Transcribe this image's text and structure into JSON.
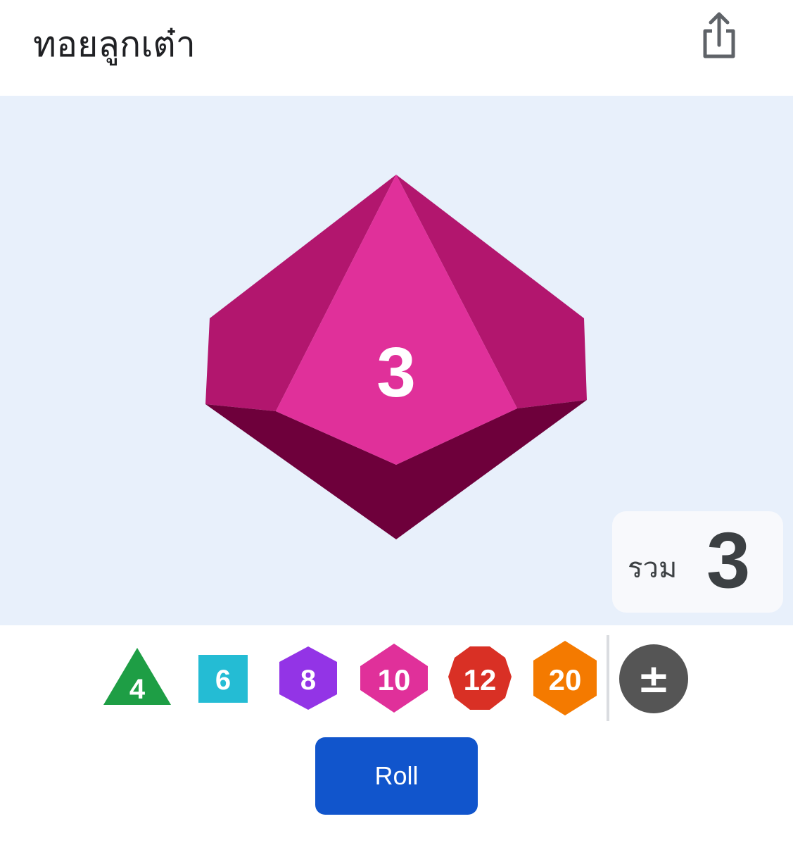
{
  "header": {
    "title": "ทอยลูกเต๋า",
    "share_icon": "share-icon"
  },
  "main_die": {
    "type": "d8",
    "face_value": "3",
    "colors": {
      "face": "#e0309a",
      "side": "#b2166e",
      "bottom": "#6e003b"
    }
  },
  "total": {
    "label": "รวม",
    "value": "3"
  },
  "dice_options": [
    {
      "label": "4",
      "shape": "triangle",
      "color": "#1e9e45"
    },
    {
      "label": "6",
      "shape": "square",
      "color": "#24bcd4"
    },
    {
      "label": "8",
      "shape": "hexagon",
      "color": "#9334e6"
    },
    {
      "label": "10",
      "shape": "diamond-hex",
      "color": "#e0309a"
    },
    {
      "label": "12",
      "shape": "decagon",
      "color": "#d93025"
    },
    {
      "label": "20",
      "shape": "hexagon",
      "color": "#f47a00"
    }
  ],
  "modifier_button": {
    "label": "±",
    "color": "#555555"
  },
  "roll_button": {
    "label": "Roll",
    "color": "#1155cc"
  }
}
